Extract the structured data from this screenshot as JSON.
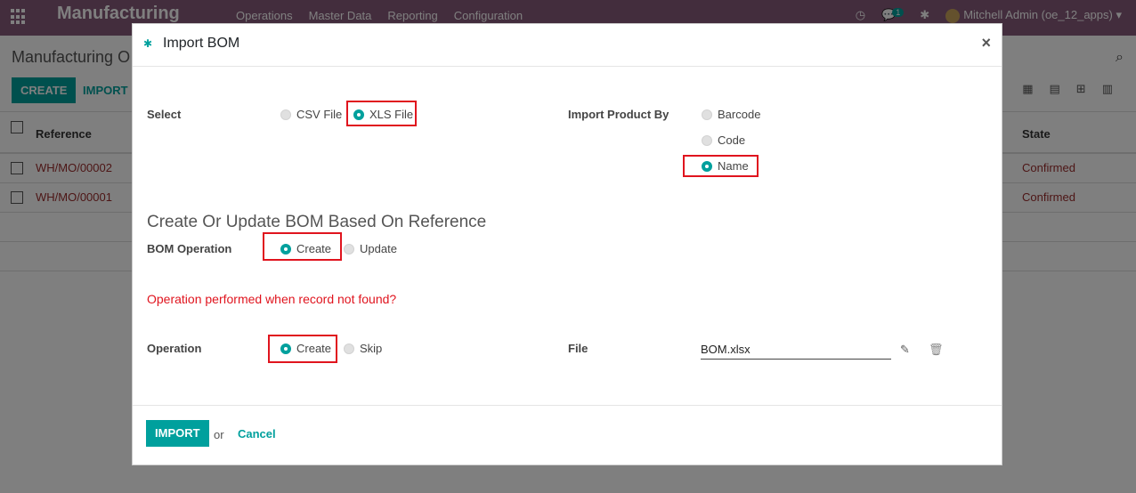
{
  "topbar": {
    "app_name": "Manufacturing",
    "menu": [
      "Operations",
      "Master Data",
      "Reporting",
      "Configuration"
    ],
    "chat_count": "1",
    "user": "Mitchell Admin (oe_12_apps)"
  },
  "control_panel": {
    "breadcrumb": "Manufacturing O",
    "create_label": "CREATE",
    "import_label": "IMPORT"
  },
  "list": {
    "columns": {
      "reference": "Reference",
      "state": "State"
    },
    "rows": [
      {
        "reference": "WH/MO/00002",
        "state": "Confirmed"
      },
      {
        "reference": "WH/MO/00001",
        "state": "Confirmed"
      }
    ]
  },
  "modal": {
    "title": "Import BOM",
    "close": "×",
    "select_label": "Select",
    "file_types": [
      "CSV File",
      "XLS File"
    ],
    "import_by_label": "Import Product By",
    "import_by_options": [
      "Barcode",
      "Code",
      "Name"
    ],
    "section_title": "Create Or Update BOM Based On Reference",
    "bom_operation_label": "BOM Operation",
    "bom_operation_options": [
      "Create",
      "Update"
    ],
    "question": "Operation performed when record not found?",
    "operation_label": "Operation",
    "operation_options": [
      "Create",
      "Skip"
    ],
    "file_label": "File",
    "file_value": "BOM.xlsx",
    "import_button": "IMPORT",
    "or_text": "or",
    "cancel_button": "Cancel"
  },
  "colors": {
    "brand": "#875a7b",
    "accent": "#00a09d",
    "highlight": "#e0141e"
  }
}
